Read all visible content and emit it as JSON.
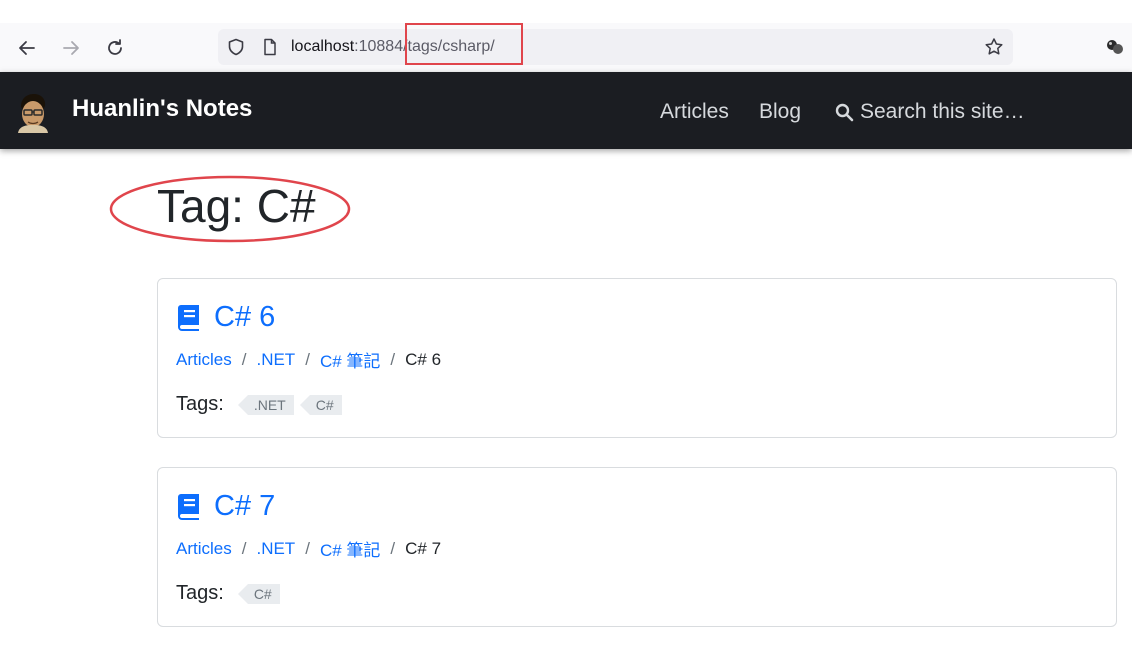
{
  "browser": {
    "url_host": "localhost",
    "url_rest": ":10884/tags/csharp/"
  },
  "site": {
    "brand": "Huanlin's Notes",
    "nav": [
      "Articles",
      "Blog"
    ],
    "search_placeholder": "Search this site…"
  },
  "page": {
    "title": "Tag: C#"
  },
  "tags_label": "Tags:",
  "cards": [
    {
      "title": "C# 6",
      "breadcrumb": [
        "Articles",
        ".NET",
        "C# 筆記"
      ],
      "current": "C# 6",
      "tags": [
        ".NET",
        "C#"
      ]
    },
    {
      "title": "C# 7",
      "breadcrumb": [
        "Articles",
        ".NET",
        "C# 筆記"
      ],
      "current": "C# 7",
      "tags": [
        "C#"
      ]
    }
  ],
  "colors": {
    "navbar": "#1b1d22",
    "link": "#0d6efd",
    "annotation": "#e0454c"
  },
  "icons": [
    "back-arrow-icon",
    "forward-arrow-icon",
    "reload-icon",
    "shield-icon",
    "page-icon",
    "star-icon",
    "extension-icon",
    "search-icon",
    "book-icon"
  ]
}
